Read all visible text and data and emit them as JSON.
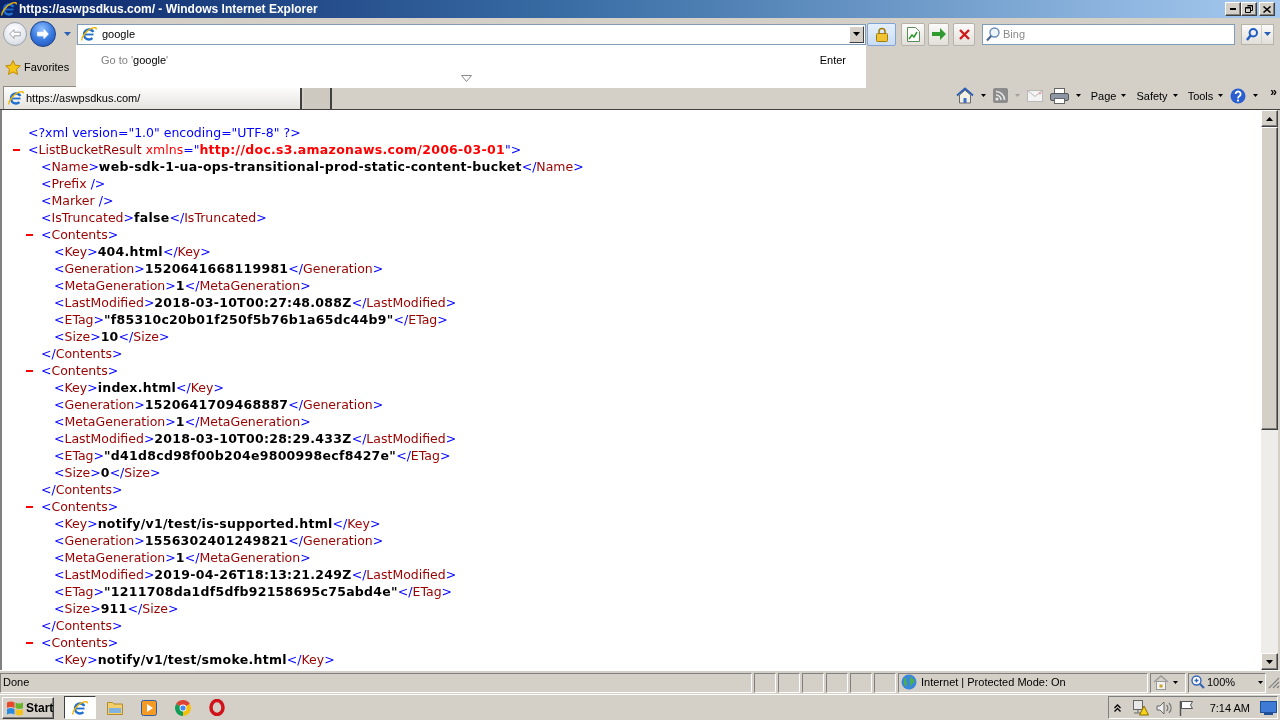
{
  "window": {
    "title": "https://aswpsdkus.com/ - Windows Internet Explorer"
  },
  "address_bar": {
    "value": "google"
  },
  "autocomplete": {
    "prefix": "Go to '",
    "query": "google",
    "suffix": "'",
    "hint": "Enter"
  },
  "search_box": {
    "placeholder": "Bing"
  },
  "favorites": {
    "label": "Favorites"
  },
  "tabs": [
    {
      "title": "https://aswpsdkus.com/",
      "selected": true
    }
  ],
  "command_bar": {
    "buttons": [
      {
        "kind": "home",
        "dropdown": true,
        "disabled": false
      },
      {
        "kind": "feeds",
        "dropdown": true,
        "disabled": true
      },
      {
        "kind": "mail",
        "dropdown": false,
        "disabled": true
      },
      {
        "kind": "print",
        "dropdown": true,
        "disabled": false
      },
      {
        "kind": "menu",
        "label": "Page",
        "dropdown": true
      },
      {
        "kind": "menu",
        "label": "Safety",
        "dropdown": true
      },
      {
        "kind": "menu",
        "label": "Tools",
        "dropdown": true
      },
      {
        "kind": "help",
        "dropdown": true,
        "disabled": false
      }
    ],
    "overflow": "»"
  },
  "document": {
    "declaration": "<?xml version=\"1.0\" encoding=\"UTF-8\" ?>",
    "root": {
      "kind": "parent",
      "tag": [
        "<",
        "ListBucketResult",
        ">"
      ],
      "attribute": {
        "name": "xmlns",
        "open_quote": "=\"",
        "value": "http://doc.s3.amazonaws.com/2006-03-01",
        "close_quote": "\""
      },
      "expanded": true,
      "children": [
        {
          "kind": "text",
          "tag": [
            "<",
            "Name",
            ">"
          ],
          "value": "web-sdk-1-ua-ops-transitional-prod-static-content-bucket",
          "end_tag": [
            "</",
            "Name",
            ">"
          ]
        },
        {
          "kind": "empty",
          "tag": [
            "<",
            "Prefix",
            "/>"
          ]
        },
        {
          "kind": "empty",
          "tag": [
            "<",
            "Marker",
            "/>"
          ]
        },
        {
          "kind": "text",
          "tag": [
            "<",
            "IsTruncated",
            ">"
          ],
          "value": "false",
          "end_tag": [
            "</",
            "IsTruncated",
            ">"
          ]
        },
        {
          "kind": "parent",
          "tag": [
            "<",
            "Contents",
            ">"
          ],
          "expanded": true,
          "children": [
            {
              "kind": "text",
              "tag": [
                "<",
                "Key",
                ">"
              ],
              "value": "404.html",
              "end_tag": [
                "</",
                "Key",
                ">"
              ]
            },
            {
              "kind": "text",
              "tag": [
                "<",
                "Generation",
                ">"
              ],
              "value": "1520641668119981",
              "end_tag": [
                "</",
                "Generation",
                ">"
              ]
            },
            {
              "kind": "text",
              "tag": [
                "<",
                "MetaGeneration",
                ">"
              ],
              "value": "1",
              "end_tag": [
                "</",
                "MetaGeneration",
                ">"
              ]
            },
            {
              "kind": "text",
              "tag": [
                "<",
                "LastModified",
                ">"
              ],
              "value": "2018-03-10T00:27:48.088Z",
              "end_tag": [
                "</",
                "LastModified",
                ">"
              ]
            },
            {
              "kind": "text",
              "tag": [
                "<",
                "ETag",
                ">"
              ],
              "value": "\"f85310c20b01f250f5b76b1a65dc44b9\"",
              "end_tag": [
                "</",
                "ETag",
                ">"
              ]
            },
            {
              "kind": "text",
              "tag": [
                "<",
                "Size",
                ">"
              ],
              "value": "10",
              "end_tag": [
                "</",
                "Size",
                ">"
              ]
            }
          ],
          "end_tag": [
            "</",
            "Contents",
            ">"
          ]
        },
        {
          "kind": "parent",
          "tag": [
            "<",
            "Contents",
            ">"
          ],
          "expanded": true,
          "children": [
            {
              "kind": "text",
              "tag": [
                "<",
                "Key",
                ">"
              ],
              "value": "index.html",
              "end_tag": [
                "</",
                "Key",
                ">"
              ]
            },
            {
              "kind": "text",
              "tag": [
                "<",
                "Generation",
                ">"
              ],
              "value": "1520641709468887",
              "end_tag": [
                "</",
                "Generation",
                ">"
              ]
            },
            {
              "kind": "text",
              "tag": [
                "<",
                "MetaGeneration",
                ">"
              ],
              "value": "1",
              "end_tag": [
                "</",
                "MetaGeneration",
                ">"
              ]
            },
            {
              "kind": "text",
              "tag": [
                "<",
                "LastModified",
                ">"
              ],
              "value": "2018-03-10T00:28:29.433Z",
              "end_tag": [
                "</",
                "LastModified",
                ">"
              ]
            },
            {
              "kind": "text",
              "tag": [
                "<",
                "ETag",
                ">"
              ],
              "value": "\"d41d8cd98f00b204e9800998ecf8427e\"",
              "end_tag": [
                "</",
                "ETag",
                ">"
              ]
            },
            {
              "kind": "text",
              "tag": [
                "<",
                "Size",
                ">"
              ],
              "value": "0",
              "end_tag": [
                "</",
                "Size",
                ">"
              ]
            }
          ],
          "end_tag": [
            "</",
            "Contents",
            ">"
          ]
        },
        {
          "kind": "parent",
          "tag": [
            "<",
            "Contents",
            ">"
          ],
          "expanded": true,
          "children": [
            {
              "kind": "text",
              "tag": [
                "<",
                "Key",
                ">"
              ],
              "value": "notify/v1/test/is-supported.html",
              "end_tag": [
                "</",
                "Key",
                ">"
              ]
            },
            {
              "kind": "text",
              "tag": [
                "<",
                "Generation",
                ">"
              ],
              "value": "1556302401249821",
              "end_tag": [
                "</",
                "Generation",
                ">"
              ]
            },
            {
              "kind": "text",
              "tag": [
                "<",
                "MetaGeneration",
                ">"
              ],
              "value": "1",
              "end_tag": [
                "</",
                "MetaGeneration",
                ">"
              ]
            },
            {
              "kind": "text",
              "tag": [
                "<",
                "LastModified",
                ">"
              ],
              "value": "2019-04-26T18:13:21.249Z",
              "end_tag": [
                "</",
                "LastModified",
                ">"
              ]
            },
            {
              "kind": "text",
              "tag": [
                "<",
                "ETag",
                ">"
              ],
              "value": "\"1211708da1df5dfb92158695c75abd4e\"",
              "end_tag": [
                "</",
                "ETag",
                ">"
              ]
            },
            {
              "kind": "text",
              "tag": [
                "<",
                "Size",
                ">"
              ],
              "value": "911",
              "end_tag": [
                "</",
                "Size",
                ">"
              ]
            }
          ],
          "end_tag": [
            "</",
            "Contents",
            ">"
          ]
        },
        {
          "kind": "parent",
          "tag": [
            "<",
            "Contents",
            ">"
          ],
          "expanded": true,
          "children": [
            {
              "kind": "text",
              "tag": [
                "<",
                "Key",
                ">"
              ],
              "value": "notify/v1/test/smoke.html",
              "end_tag": [
                "</",
                "Key",
                ">"
              ]
            }
          ]
        }
      ]
    }
  },
  "status_bar": {
    "text": "Done",
    "zone": "Internet | Protected Mode: On",
    "zoom": "100%"
  },
  "taskbar": {
    "start": "Start",
    "apps": [
      {
        "kind": "ie",
        "selected": true
      },
      {
        "kind": "folder",
        "selected": false
      },
      {
        "kind": "player",
        "selected": false
      },
      {
        "kind": "chrome",
        "selected": false
      },
      {
        "kind": "opera",
        "selected": false
      }
    ],
    "clock": "7:14 AM"
  }
}
